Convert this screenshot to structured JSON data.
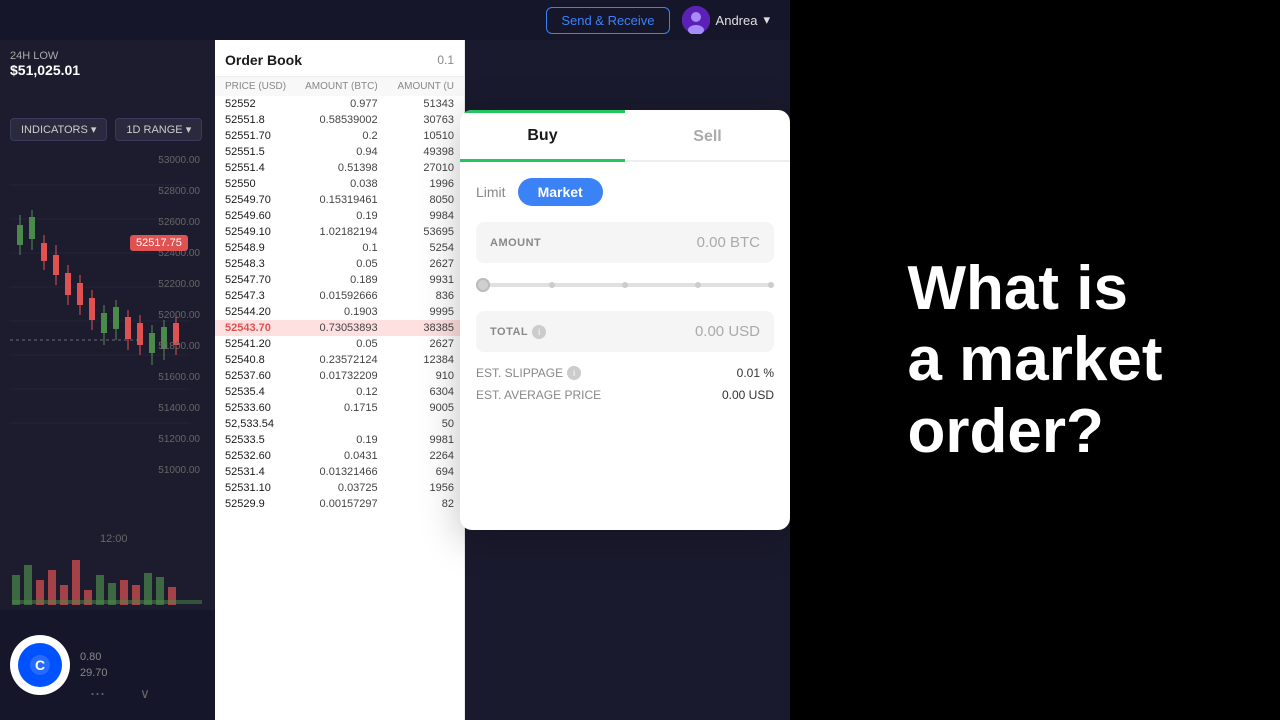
{
  "header": {
    "low_label": "24H LOW",
    "low_price": "$51,025.01",
    "send_receive_btn": "Send & Receive",
    "user_name": "Andrea",
    "chevron": "▾"
  },
  "chart_controls": {
    "indicators_btn": "INDICATORS ▾",
    "range_btn": "1D RANGE ▾"
  },
  "price_scale": {
    "prices": [
      "53000.00",
      "52800.00",
      "52600.00",
      "52400.00",
      "52200.00",
      "52000.00",
      "51800.00",
      "51600.00",
      "51400.00",
      "51200.00",
      "51000.00"
    ]
  },
  "current_price": "52517.75",
  "time_label": "12:00",
  "order_book": {
    "title": "Order Book",
    "spread": "0.1",
    "columns": [
      "PRICE (USD)",
      "AMOUNT (BTC)",
      "AMOUNT (U"
    ],
    "rows": [
      {
        "price": "52552",
        "amount": "0.977",
        "total": "51343",
        "highlight": false
      },
      {
        "price": "52551.8",
        "amount": "0.58539002",
        "total": "30763",
        "highlight": false
      },
      {
        "price": "52551.70",
        "amount": "0.2",
        "total": "10510",
        "highlight": false
      },
      {
        "price": "52551.5",
        "amount": "0.94",
        "total": "49398",
        "highlight": false
      },
      {
        "price": "52551.4",
        "amount": "0.51398",
        "total": "27010",
        "highlight": false
      },
      {
        "price": "52550",
        "amount": "0.038",
        "total": "1996",
        "highlight": false
      },
      {
        "price": "52549.70",
        "amount": "0.15319461",
        "total": "8050",
        "highlight": false
      },
      {
        "price": "52549.60",
        "amount": "0.19",
        "total": "9984",
        "highlight": false
      },
      {
        "price": "52549.10",
        "amount": "1.02182194",
        "total": "53695",
        "highlight": false
      },
      {
        "price": "52548.9",
        "amount": "0.1",
        "total": "5254",
        "highlight": false
      },
      {
        "price": "52548.3",
        "amount": "0.05",
        "total": "2627",
        "highlight": false
      },
      {
        "price": "52547.70",
        "amount": "0.189",
        "total": "9931",
        "highlight": false
      },
      {
        "price": "52547.3",
        "amount": "0.01592666",
        "total": "836",
        "highlight": false
      },
      {
        "price": "52544.20",
        "amount": "0.1903",
        "total": "9995",
        "highlight": false
      },
      {
        "price": "52543.70",
        "amount": "0.73053893",
        "total": "38385",
        "highlight": true
      },
      {
        "price": "52541.20",
        "amount": "0.05",
        "total": "2627",
        "highlight": false
      },
      {
        "price": "52540.8",
        "amount": "0.23572124",
        "total": "12384",
        "highlight": false
      },
      {
        "price": "52537.60",
        "amount": "0.01732209",
        "total": "910",
        "highlight": false
      },
      {
        "price": "52535.4",
        "amount": "0.12",
        "total": "6304",
        "highlight": false
      },
      {
        "price": "52533.60",
        "amount": "0.1715",
        "total": "9005",
        "highlight": false
      },
      {
        "price": "52,533.54",
        "amount": "",
        "total": "50",
        "highlight": false
      },
      {
        "price": "52533.5",
        "amount": "0.19",
        "total": "9981",
        "highlight": false
      },
      {
        "price": "52532.60",
        "amount": "0.0431",
        "total": "2264",
        "highlight": false
      },
      {
        "price": "52531.4",
        "amount": "0.01321466",
        "total": "694",
        "highlight": false
      },
      {
        "price": "52531.10",
        "amount": "0.03725",
        "total": "1956",
        "highlight": false
      },
      {
        "price": "52529.9",
        "amount": "0.00157297",
        "total": "82",
        "highlight": false
      }
    ]
  },
  "dialog": {
    "tab_buy": "Buy",
    "tab_sell": "Sell",
    "order_type_limit": "Limit",
    "order_type_market": "Market",
    "amount_label": "AMOUNT",
    "amount_value": "0.00 BTC",
    "total_label": "TOTAL",
    "total_value": "0.00 USD",
    "est_slippage_label": "EST. SLIPPAGE",
    "est_slippage_value": "0.01 %",
    "est_avg_price_label": "EST. AVERAGE PRICE",
    "est_avg_price_value": "0.00 USD"
  },
  "right_panel": {
    "headline_line1": "What is",
    "headline_line2": "a market",
    "headline_line3": "order?"
  },
  "bottom": {
    "price1": "0.80",
    "price2": "29.70",
    "more": "...",
    "expand": "∨"
  },
  "colors": {
    "buy_tab_indicator": "#22c55e",
    "market_btn": "#3b82f6",
    "highlight_row_bg": "#ffe8e8",
    "red_price": "#e05252",
    "send_receive_border": "#3b82f6"
  }
}
